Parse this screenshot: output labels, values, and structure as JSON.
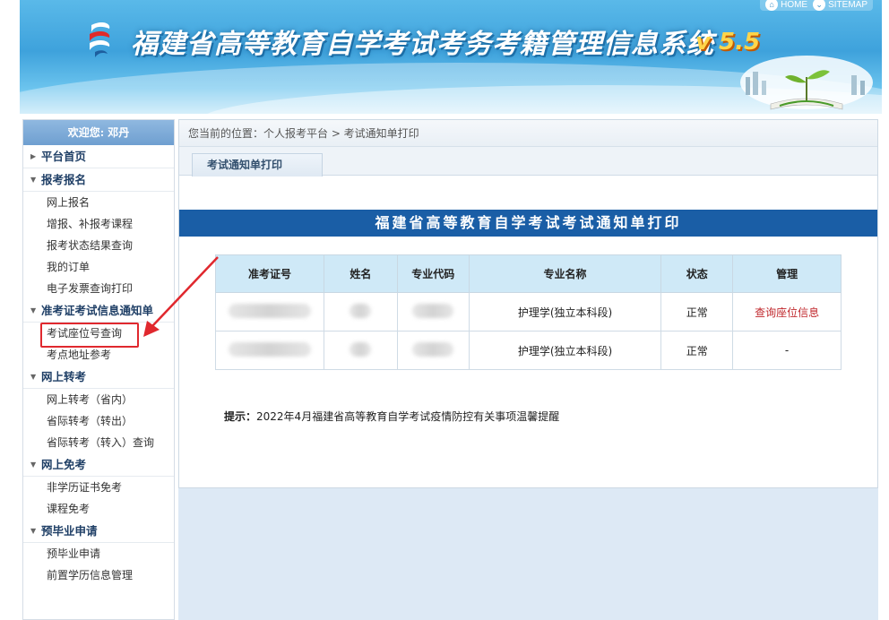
{
  "header": {
    "title": "福建省高等教育自学考试考务考籍管理信息系统",
    "version": "v 5.5",
    "links": [
      {
        "label": "HOME",
        "icon": "home-icon"
      },
      {
        "label": "SITEMAP",
        "icon": "chevron-down-icon"
      }
    ]
  },
  "sidebar": {
    "welcome": "欢迎您: 邓丹",
    "sections": [
      {
        "title": "平台首页",
        "items": []
      },
      {
        "title": "报考报名",
        "items": [
          "网上报名",
          "增报、补报考课程",
          "报考状态结果查询",
          "我的订单",
          "电子发票查询打印"
        ]
      },
      {
        "title": "准考证考试信息通知单",
        "items": [
          "考试座位号查询",
          "考点地址参考"
        ]
      },
      {
        "title": "网上转考",
        "items": [
          "网上转考（省内）",
          "省际转考（转出）",
          "省际转考（转入）查询"
        ]
      },
      {
        "title": "网上免考",
        "items": [
          "非学历证书免考",
          "课程免考"
        ]
      },
      {
        "title": "预毕业申请",
        "items": [
          "预毕业申请",
          "前置学历信息管理"
        ]
      }
    ],
    "highlighted_item": "考试座位号查询"
  },
  "main": {
    "breadcrumb": "您当前的位置：个人报考平台 > 考试通知单打印",
    "tab_label": "考试通知单打印",
    "banner_title": "福建省高等教育自学考试考试通知单打印",
    "table": {
      "headers": [
        "准考证号",
        "姓名",
        "专业代码",
        "专业名称",
        "状态",
        "管理"
      ],
      "rows": [
        {
          "major": "护理学(独立本科段)",
          "status": "正常",
          "action": "查询座位信息"
        },
        {
          "major": "护理学(独立本科段)",
          "status": "正常",
          "action": "-"
        }
      ]
    },
    "notice_label": "提示：",
    "notice_text": "2022年4月福建省高等教育自学考试疫情防控有关事项温馨提醒"
  },
  "colors": {
    "banner_blue": "#3ea2dc",
    "title_bar": "#1a5ea6",
    "table_header": "#cfe9f7",
    "link_red": "#c0282d",
    "highlight_box": "#e0282e"
  }
}
